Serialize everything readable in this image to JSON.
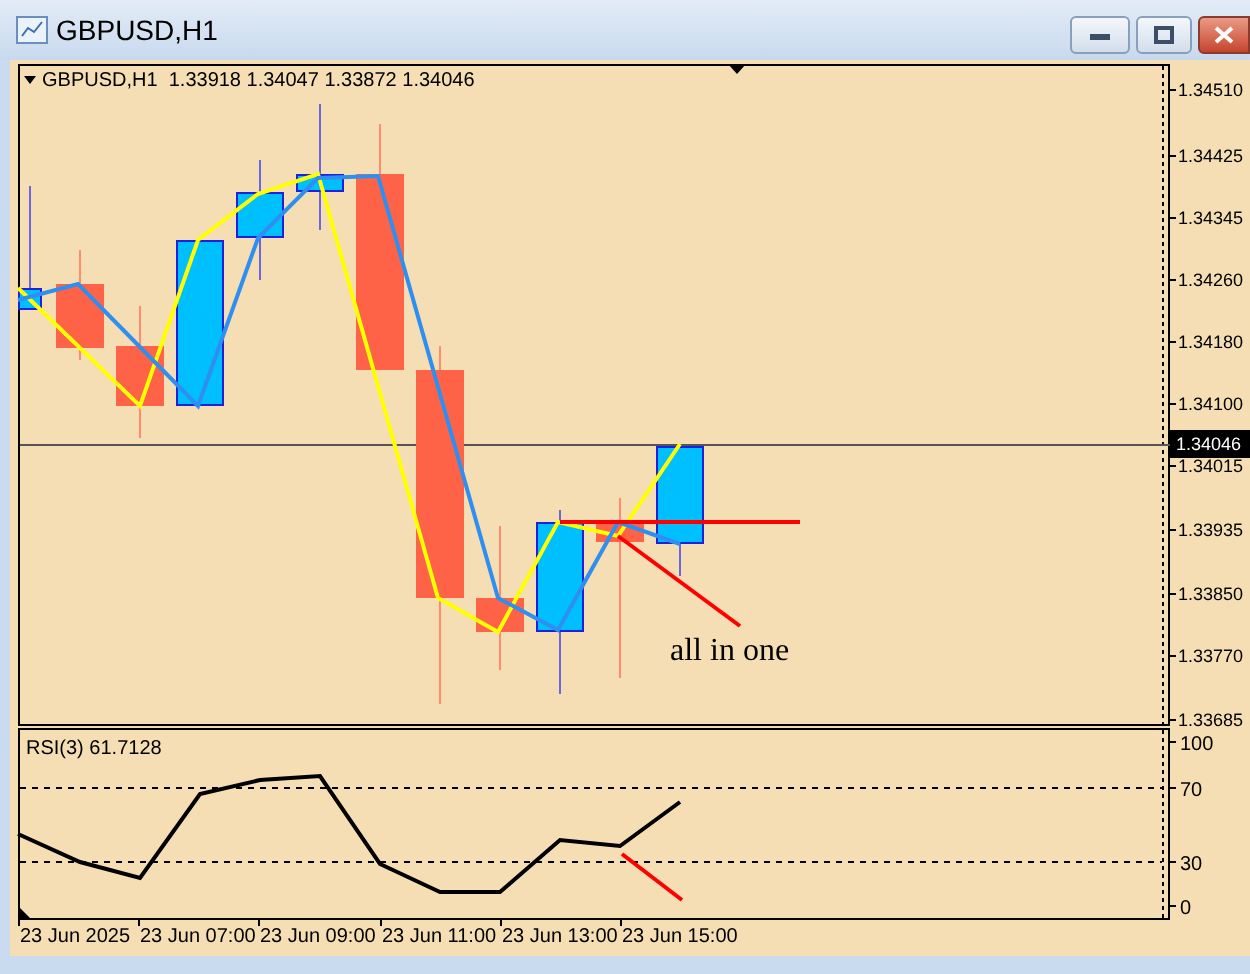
{
  "window": {
    "title": "GBPUSD,H1"
  },
  "chart": {
    "header": "GBPUSD,H1  1.33918 1.34047 1.33872 1.34046",
    "annotation": "all in one",
    "current_price": "1.34046",
    "price_ticks": [
      "1.34510",
      "1.34425",
      "1.34345",
      "1.34260",
      "1.34180",
      "1.34100",
      "1.34015",
      "1.33935",
      "1.33850",
      "1.33770",
      "1.33685"
    ]
  },
  "rsi": {
    "label": "RSI(3) 61.7128",
    "levels": [
      "100",
      "70",
      "30",
      "0"
    ]
  },
  "time_labels": [
    "23 Jun 2025",
    "23 Jun 07:00",
    "23 Jun 09:00",
    "23 Jun 11:00",
    "23 Jun 13:00",
    "23 Jun 15:00"
  ]
}
